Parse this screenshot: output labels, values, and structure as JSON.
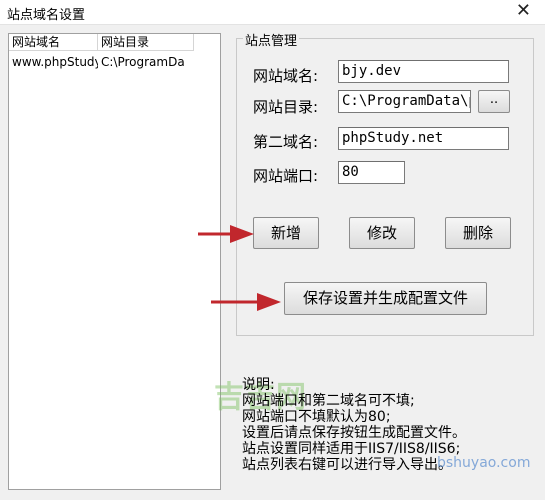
{
  "window": {
    "title": "站点域名设置",
    "close_glyph": "✕"
  },
  "site_list": {
    "columns": [
      "网站域名",
      "网站目录"
    ],
    "rows": [
      {
        "domain": "www.phpStudy",
        "dir": "C:\\ProgramDa"
      }
    ]
  },
  "group": {
    "title": "站点管理",
    "fields": {
      "domain": {
        "label": "网站域名:",
        "value": "bjy.dev"
      },
      "dir": {
        "label": "网站目录:",
        "value": "C:\\ProgramData\\p"
      },
      "second": {
        "label": "第二域名:",
        "value": "phpStudy.net"
      },
      "port": {
        "label": "网站端口:",
        "value": "80"
      }
    },
    "browse_label": "..",
    "buttons": {
      "add": "新增",
      "edit": "修改",
      "delete": "删除"
    },
    "save_label": "保存设置并生成配置文件"
  },
  "notes": [
    "说明:",
    "网站端口和第二域名可不填;",
    "网站端口不填默认为80;",
    "设置后请点保存按钮生成配置文件。",
    "站点设置同样适用于IIS7/IIS8/IIS6;",
    "站点列表右键可以进行导入导出。"
  ],
  "watermark": {
    "logo": "吉吉网",
    "url": "bshuyao.com"
  },
  "colors": {
    "arrow": "#c1272d"
  }
}
